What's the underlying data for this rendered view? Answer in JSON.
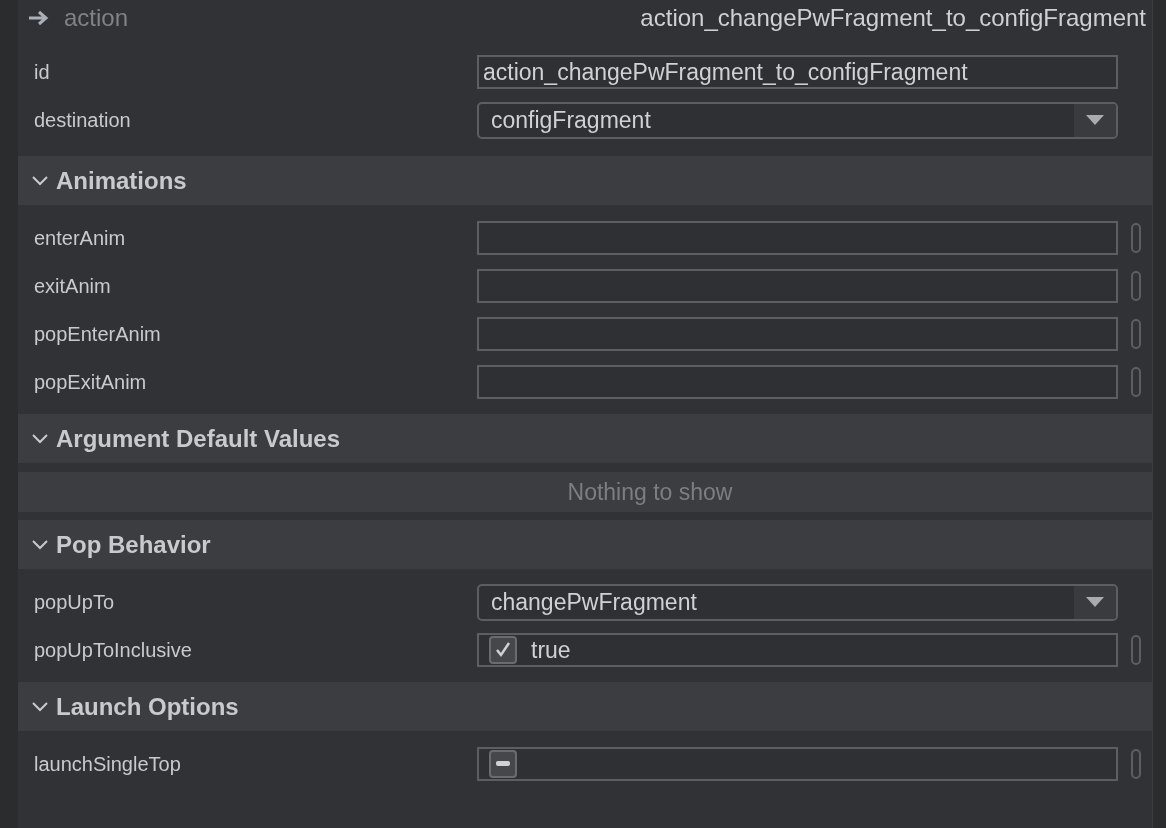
{
  "header": {
    "type_label": "action",
    "name": "action_changePwFragment_to_configFragment"
  },
  "properties": [
    {
      "label": "id",
      "kind": "text",
      "value": "action_changePwFragment_to_configFragment",
      "resource_button": false
    },
    {
      "label": "destination",
      "kind": "dropdown",
      "value": "configFragment"
    }
  ],
  "sections": [
    {
      "title": "Animations",
      "expanded": true,
      "properties": [
        {
          "label": "enterAnim",
          "kind": "text",
          "resource_button": true
        },
        {
          "label": "exitAnim",
          "kind": "text",
          "resource_button": true
        },
        {
          "label": "popEnterAnim",
          "kind": "text",
          "resource_button": true
        },
        {
          "label": "popExitAnim",
          "kind": "text",
          "resource_button": true
        }
      ]
    },
    {
      "title": "Argument Default Values",
      "expanded": true,
      "empty_message": "Nothing to show"
    },
    {
      "title": "Pop Behavior",
      "expanded": true,
      "properties": [
        {
          "label": "popUpTo",
          "kind": "dropdown",
          "value": "changePwFragment"
        },
        {
          "label": "popUpToInclusive",
          "kind": "checkbox",
          "checked": true,
          "value": "true",
          "resource_button": true
        }
      ]
    },
    {
      "title": "Launch Options",
      "expanded": true,
      "properties": [
        {
          "label": "launchSingleTop",
          "kind": "checkbox",
          "indeterminate": true,
          "resource_button": true
        }
      ]
    }
  ]
}
